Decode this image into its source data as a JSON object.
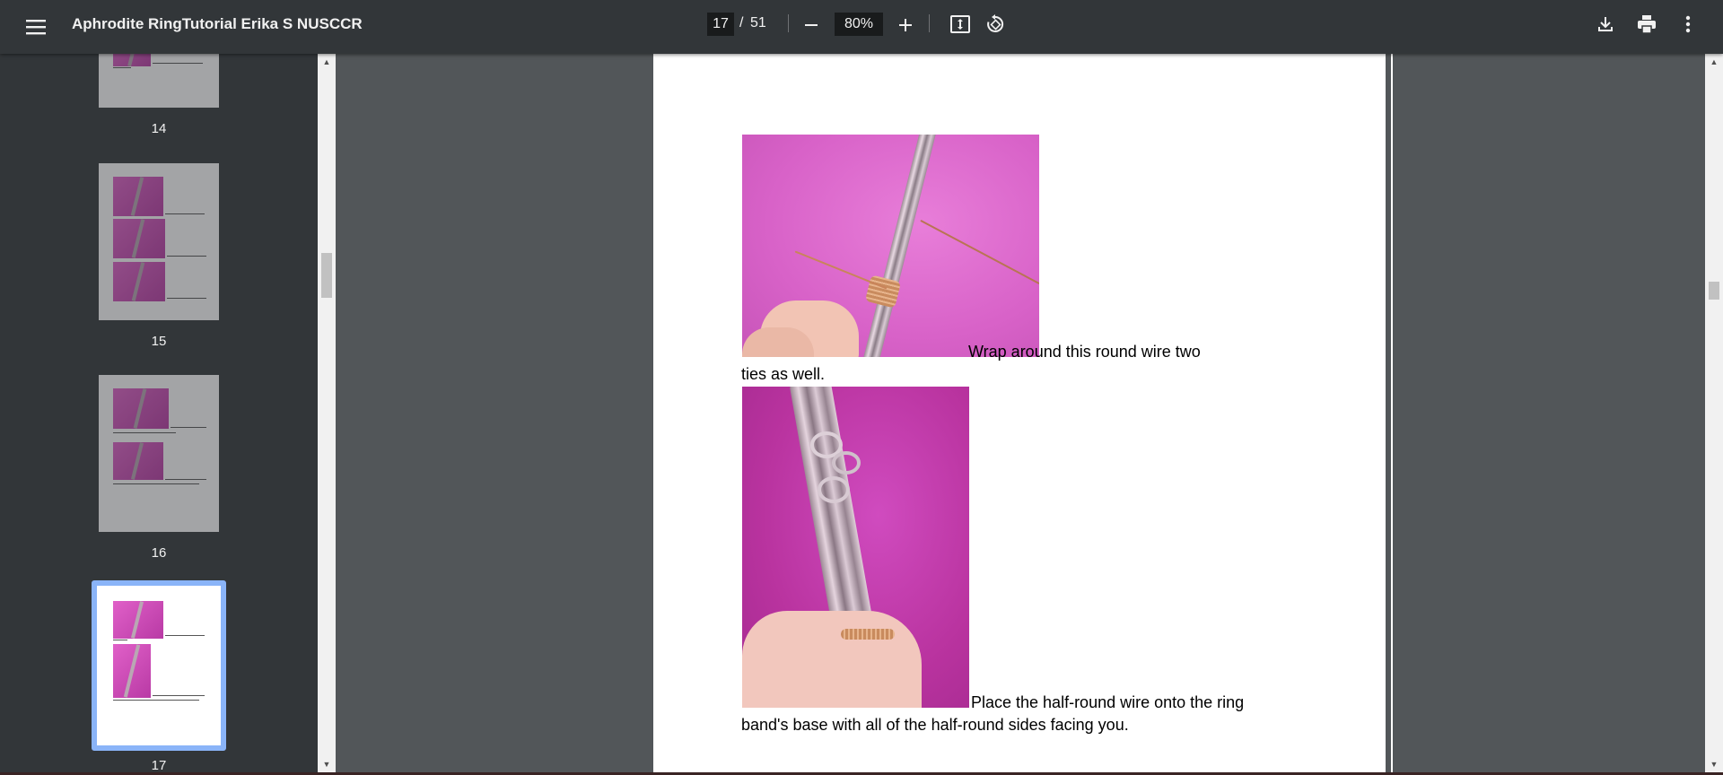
{
  "toolbar": {
    "title": "Aphrodite RingTutorial Erika S NUSCCR",
    "page_current": "17",
    "page_separator": "/",
    "page_total": "51",
    "zoom": "80%"
  },
  "sidebar": {
    "thumbnails": [
      {
        "label": "14"
      },
      {
        "label": "15"
      },
      {
        "label": "16"
      },
      {
        "label": "17"
      }
    ],
    "selected": "17"
  },
  "page": {
    "para1_line1": "Wrap around this round wire two",
    "para1_line2": "ties as well.",
    "para2_line1": "Place the half-round wire onto the ring",
    "para2_line2": "band's base with all of the half-round sides facing you."
  },
  "icons": {
    "menu": "menu-icon",
    "zoom_out": "minus-icon",
    "zoom_in": "plus-icon",
    "fit": "fit-page-icon",
    "rotate": "rotate-icon",
    "download": "download-icon",
    "print": "print-icon",
    "more": "more-vert-icon"
  },
  "colors": {
    "toolbar": "#323639",
    "viewer_bg": "#525659",
    "selection": "#8ab4f8"
  }
}
